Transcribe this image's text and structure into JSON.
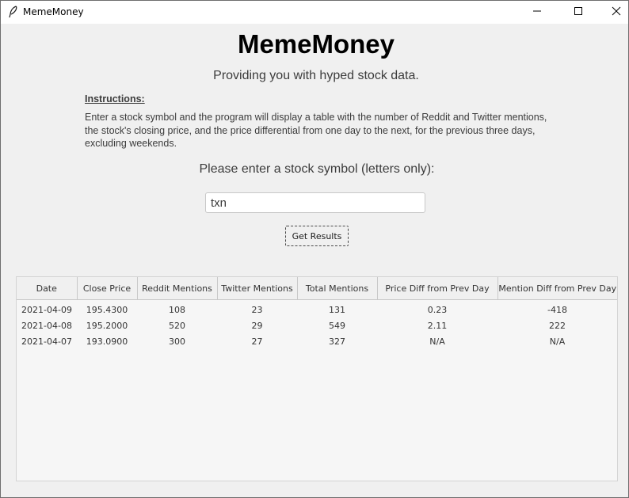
{
  "window": {
    "title": "MemeMoney",
    "controls": {
      "minimize_icon": "minimize-icon",
      "maximize_icon": "maximize-icon",
      "close_icon": "close-icon"
    }
  },
  "header": {
    "title": "MemeMoney",
    "subtitle": "Providing you with hyped stock data."
  },
  "instructions": {
    "heading": "Instructions:",
    "text": "Enter a stock symbol and the program will display a table with the number of Reddit and Twitter mentions, the stock's closing price, and the price differential from one day to the next, for the previous three days, excluding weekends."
  },
  "search": {
    "label": "Please enter a stock symbol (letters only):",
    "value": "txn",
    "button_label": "Get Results"
  },
  "table": {
    "columns": [
      "Date",
      "Close Price",
      "Reddit Mentions",
      "Twitter Mentions",
      "Total Mentions",
      "Price Diff from Prev Day",
      "Mention Diff from Prev Day"
    ],
    "rows": [
      [
        "2021-04-09",
        "195.4300",
        "108",
        "23",
        "131",
        "0.23",
        "-418"
      ],
      [
        "2021-04-08",
        "195.2000",
        "520",
        "29",
        "549",
        "2.11",
        "222"
      ],
      [
        "2021-04-07",
        "193.0900",
        "300",
        "27",
        "327",
        "N/A",
        "N/A"
      ]
    ]
  },
  "colors": {
    "window_bg": "#f0f0f0",
    "titlebar_bg": "#ffffff",
    "text": "#3c3c3c"
  }
}
